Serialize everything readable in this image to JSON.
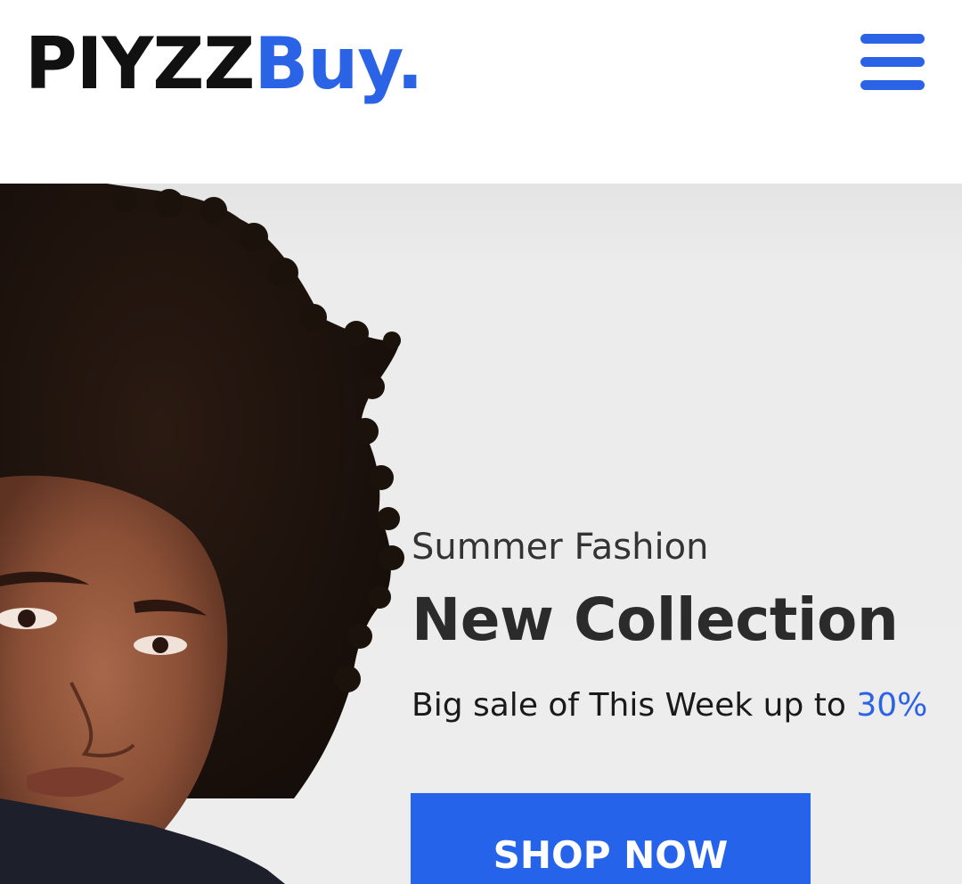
{
  "header": {
    "logo_main": "PIYZZ",
    "logo_accent": "Buy.",
    "menu_icon": "hamburger-menu-icon"
  },
  "hero": {
    "subtitle": "Summer Fashion",
    "title": "New Collection",
    "sale_prefix": "Big sale of This Week up to ",
    "sale_percent": "30%",
    "cta_label": "SHOP NOW",
    "image_subject": "model-portrait"
  },
  "colors": {
    "accent": "#2563eb",
    "text_dark": "#2b2b2b",
    "hero_bg": "#ededed"
  }
}
